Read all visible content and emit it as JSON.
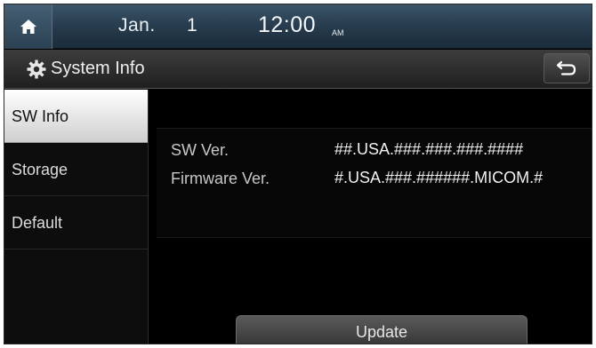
{
  "status": {
    "date": "Jan.",
    "day": "1",
    "time": "12:00",
    "ampm": "AM"
  },
  "header": {
    "title": "System Info"
  },
  "sidebar": {
    "items": [
      {
        "label": "SW Info",
        "active": true
      },
      {
        "label": "Storage",
        "active": false
      },
      {
        "label": "Default",
        "active": false
      }
    ]
  },
  "info": {
    "sw_label": "SW Ver.",
    "sw_value": "##.USA.###.###.###.####",
    "fw_label": "Firmware Ver.",
    "fw_value": "#.USA.###.######.MICOM.#"
  },
  "actions": {
    "update_label": "Update"
  },
  "icons": {
    "home": "home-icon",
    "settings": "gear-icon",
    "back": "back-arrow-icon"
  },
  "colors": {
    "status_bar": "#2b4152",
    "active_tab": "#ffffff",
    "background": "#000000"
  }
}
